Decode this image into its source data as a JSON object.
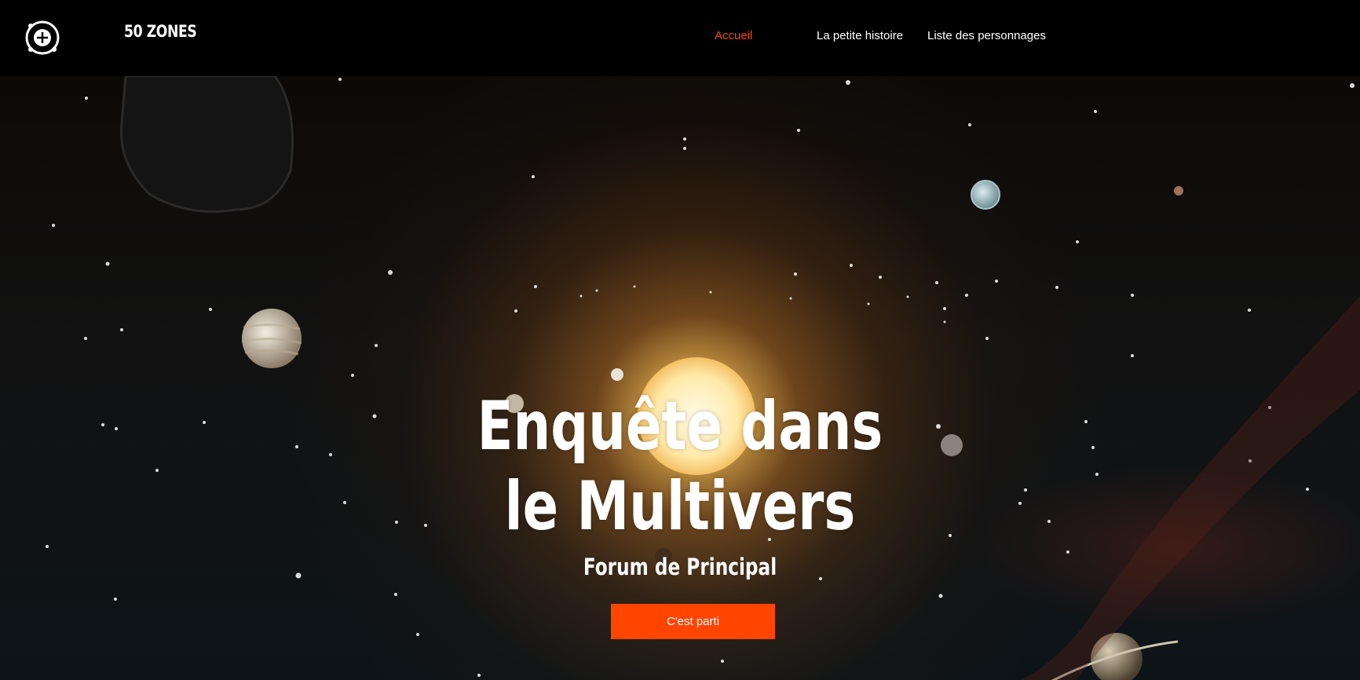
{
  "header": {
    "brand": "50 ZONES",
    "nav": [
      {
        "label": "Accueil",
        "active": true
      },
      {
        "label": "La petite histoire",
        "active": false
      },
      {
        "label": "Liste des personnages",
        "active": false
      }
    ]
  },
  "hero": {
    "title_line1": "Enquête dans",
    "title_line2": "le Multivers",
    "subtitle": "Forum de Principal",
    "cta_label": "C'est parti"
  },
  "colors": {
    "accent": "#ff4500",
    "header_bg": "#000000",
    "text": "#ffffff"
  },
  "icons": {
    "logo": "orbit-logo-icon"
  }
}
